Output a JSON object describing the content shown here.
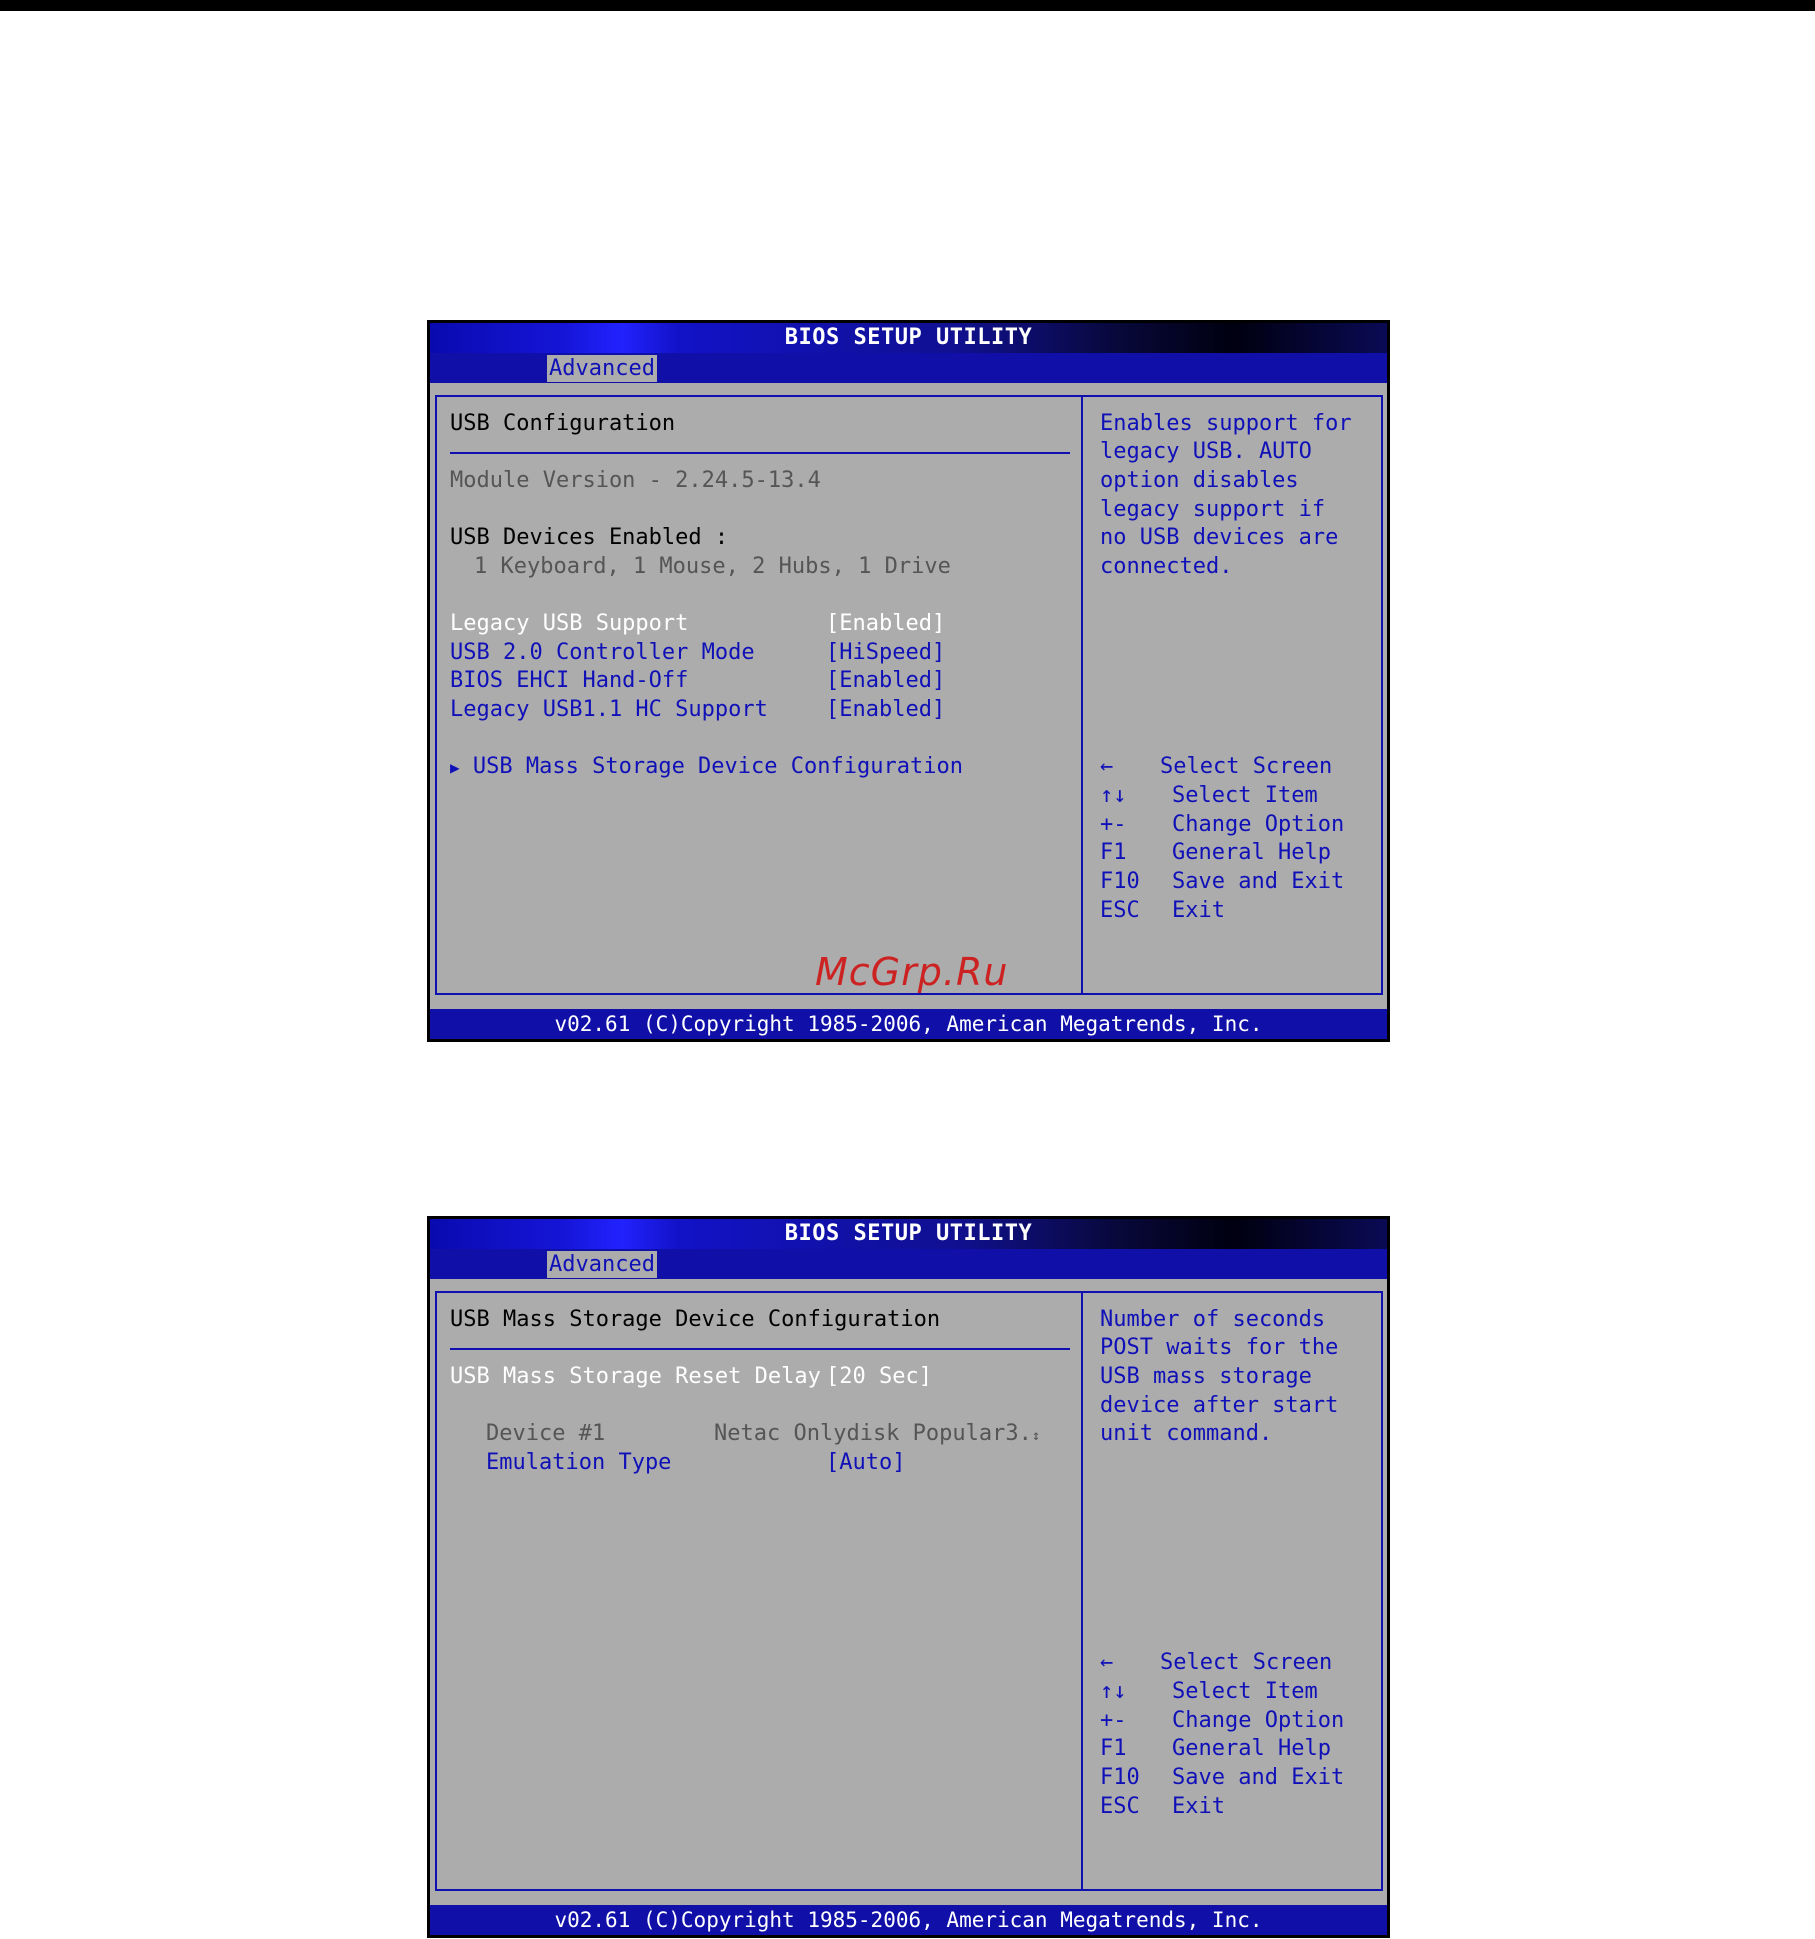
{
  "screens": [
    {
      "title": "BIOS SETUP UTILITY",
      "active_tab": "Advanced",
      "heading": "USB Configuration",
      "module_version": "Module Version - 2.24.5-13.4",
      "devices_label": "USB Devices Enabled :",
      "devices_value": "1 Keyboard, 1 Mouse, 2 Hubs, 1 Drive",
      "settings": [
        {
          "label": "Legacy USB Support",
          "value": "[Enabled]"
        },
        {
          "label": "USB 2.0 Controller Mode",
          "value": "[HiSpeed]"
        },
        {
          "label": "BIOS EHCI Hand-Off",
          "value": "[Enabled]"
        },
        {
          "label": "Legacy USB1.1 HC Support",
          "value": "[Enabled]"
        }
      ],
      "submenu": "USB Mass Storage Device Configuration",
      "help_lines": [
        "Enables support for",
        "legacy USB. AUTO",
        "option disables",
        "legacy support if",
        "no USB devices are",
        "connected."
      ],
      "watermark": "McGrp.Ru",
      "footer": "v02.61 (C)Copyright 1985-2006, American Megatrends, Inc."
    },
    {
      "title": "BIOS SETUP UTILITY",
      "active_tab": "Advanced",
      "heading": "USB Mass Storage Device Configuration",
      "reset_delay_label": "USB Mass Storage Reset Delay",
      "reset_delay_value": "[20 Sec]",
      "device_label": "Device #1",
      "device_value": "Netac Onlydisk Popular3.",
      "emulation_label": "Emulation Type",
      "emulation_value": "[Auto]",
      "help_lines": [
        "Number of seconds",
        "POST waits for the",
        "USB mass storage",
        "device after start",
        "unit command."
      ],
      "footer": "v02.61 (C)Copyright 1985-2006, American Megatrends, Inc."
    }
  ],
  "key_legend": [
    {
      "key": "←",
      "action": "Select Screen"
    },
    {
      "key": "↑↓",
      "action": "Select Item"
    },
    {
      "key": "+-",
      "action": "Change Option"
    },
    {
      "key": "F1",
      "action": "General Help"
    },
    {
      "key": "F10",
      "action": "Save and Exit"
    },
    {
      "key": "ESC",
      "action": "Exit"
    }
  ]
}
